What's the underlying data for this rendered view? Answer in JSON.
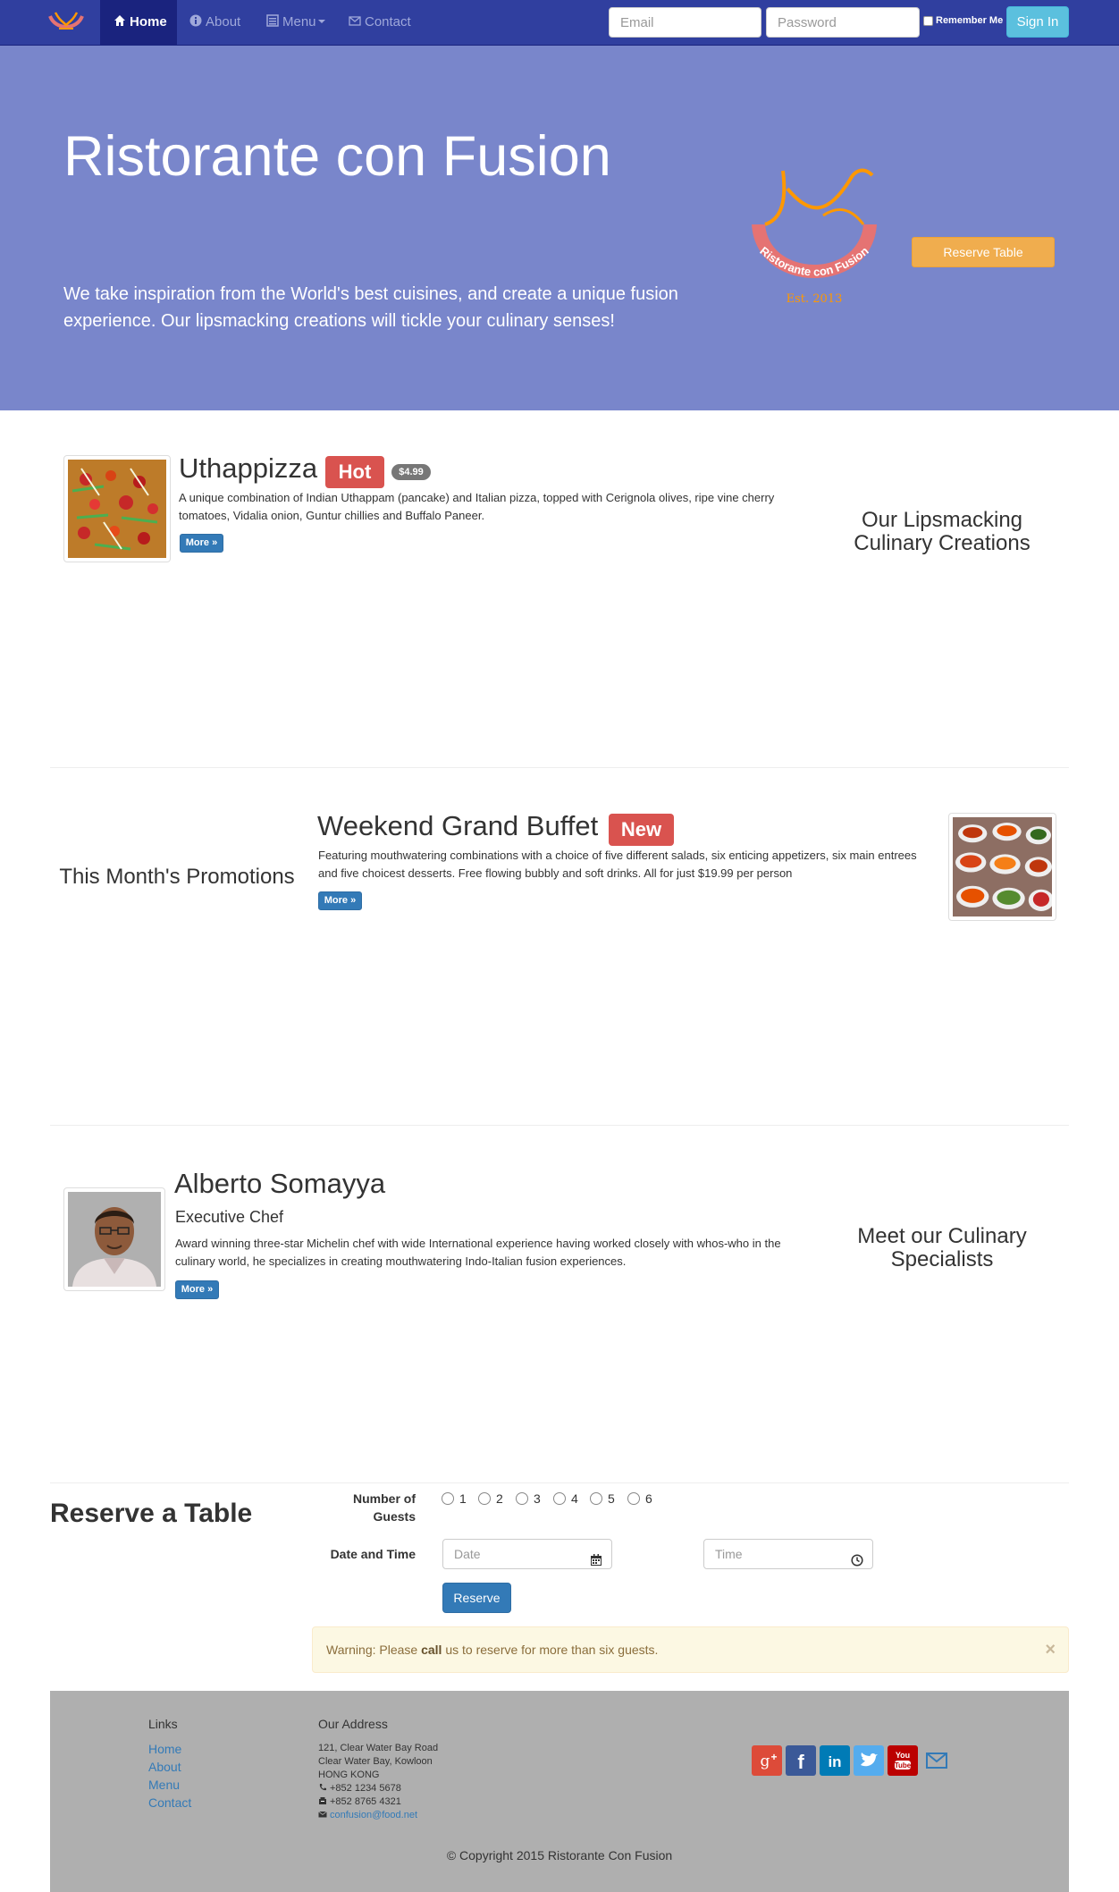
{
  "nav": {
    "items": [
      {
        "label": "Home",
        "icon": "home-icon",
        "active": true
      },
      {
        "label": "About",
        "icon": "info-icon"
      },
      {
        "label": "Menu",
        "icon": "list-icon"
      },
      {
        "label": "Contact",
        "icon": "envelope-icon"
      }
    ],
    "login": {
      "email_placeholder": "Email",
      "password_placeholder": "Password",
      "remember_label": "Remember Me",
      "signin_label": "Sign In"
    }
  },
  "jumbotron": {
    "title": "Ristorante con Fusion",
    "text": "We take inspiration from the World's best cuisines, and create a unique fusion experience. Our lipsmacking creations will tickle your culinary senses!",
    "logo_text": "Ristorante con Fusion",
    "logo_est": "Est. 2013",
    "reserve_label": "Reserve Table"
  },
  "dish": {
    "name": "Uthappizza",
    "badge": "Hot",
    "price": "$4.99",
    "description": "A unique combination of Indian Uthappam (pancake) and Italian pizza, topped with Cerignola olives, ripe vine cherry tomatoes, Vidalia onion, Guntur chillies and Buffalo Paneer.",
    "more_label": "More »",
    "side_heading": "Our Lipsmacking Culinary Creations"
  },
  "promotion": {
    "name": "Weekend Grand Buffet",
    "badge": "New",
    "description": "Featuring mouthwatering combinations with a choice of five different salads, six enticing appetizers, six main entrees and five choicest desserts. Free flowing bubbly and soft drinks. All for just $19.99 per person",
    "more_label": "More »",
    "side_heading": "This Month's Promotions"
  },
  "chef": {
    "name": "Alberto Somayya",
    "role": "Executive Chef",
    "description": "Award winning three-star Michelin chef with wide International experience having worked closely with whos-who in the culinary world, he specializes in creating mouthwatering Indo-Italian fusion experiences.",
    "more_label": "More »",
    "side_heading": "Meet our Culinary Specialists"
  },
  "reservation": {
    "title": "Reserve a Table",
    "guests_label": "Number of Guests",
    "guest_options": [
      "1",
      "2",
      "3",
      "4",
      "5",
      "6"
    ],
    "datetime_label": "Date and Time",
    "date_placeholder": "Date",
    "time_placeholder": "Time",
    "submit_label": "Reserve",
    "warning_prefix": "Warning: Please",
    "warning_bold": "call",
    "warning_suffix": "us to reserve for more than six guests.",
    "close_label": "×"
  },
  "footer": {
    "links_heading": "Links",
    "links": [
      "Home",
      "About",
      "Menu",
      "Contact"
    ],
    "address_heading": "Our Address",
    "address_lines": [
      "121, Clear Water Bay Road",
      "Clear Water Bay, Kowloon",
      "HONG KONG"
    ],
    "phone": "+852 1234 5678",
    "fax": "+852 8765 4321",
    "email": "confusion@food.net",
    "social": [
      "google-plus-icon",
      "facebook-icon",
      "linkedin-icon",
      "twitter-icon",
      "youtube-icon",
      "envelope-icon"
    ],
    "copyright": "© Copyright 2015 Ristorante Con Fusion"
  },
  "colors": {
    "navbar": "#303f9f",
    "navbar_active": "#1a237e",
    "jumbotron": "#7986cb",
    "reserve_button": "#f0ad4e",
    "signin_button": "#5bc0de",
    "primary": "#337ab7",
    "danger": "#d9534f",
    "footer": "#afafaf"
  }
}
